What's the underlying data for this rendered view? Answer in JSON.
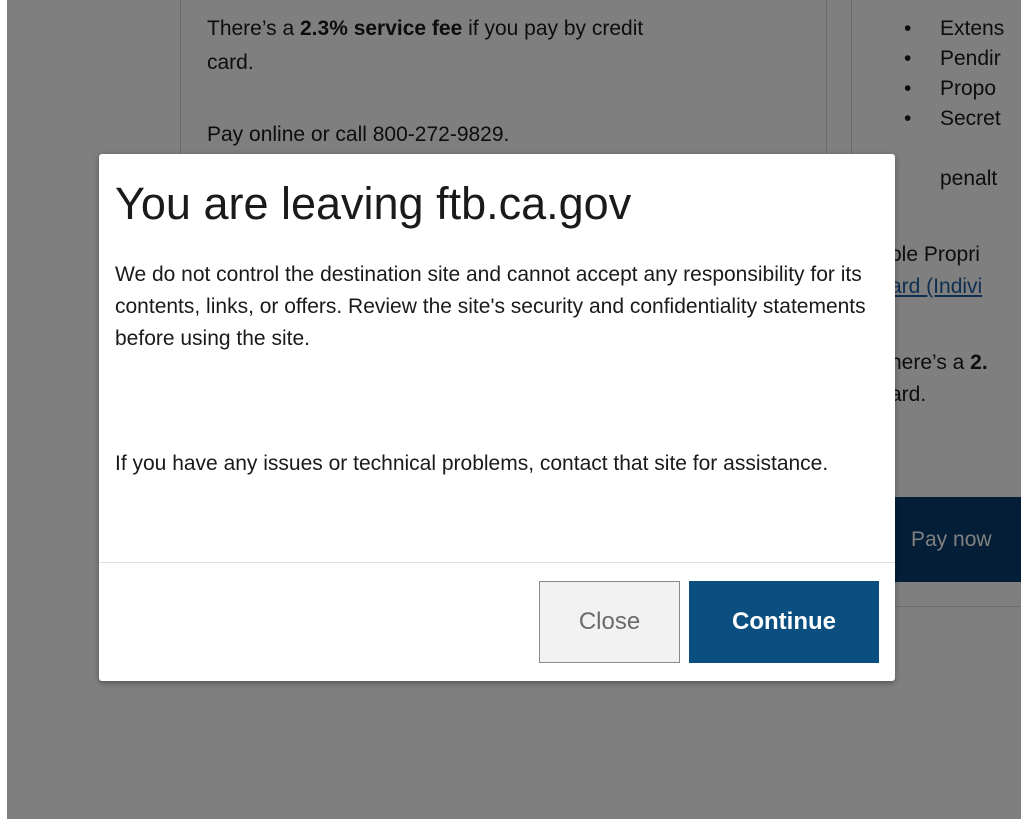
{
  "background": {
    "left_card": {
      "fee_prefix": "There’s a ",
      "fee_bold": "2.3% service fee",
      "fee_suffix": " if you pay by credit",
      "fee_line2": "card.",
      "pay_text": "Pay online or call 800-272-9829."
    },
    "right_card": {
      "bullets": [
        "Extens",
        "Pendir",
        "Propo",
        "Secret"
      ],
      "bullet_continuation": "penalt",
      "sole_prop": "ole Propri",
      "card_link": "ard (Indivi",
      "fee_prefix": "here’s a ",
      "fee_bold": "2.",
      "fee_line2": "ard.",
      "pay_now_label": "Pay now"
    }
  },
  "modal": {
    "title": "You are leaving ftb.ca.gov",
    "paragraph1": "We do not control the destination site and cannot accept any responsibility for its contents, links, or offers. Review the site's security and confidentiality statements before using the site.",
    "paragraph2": "If you have any issues or technical problems, contact that site for assistance.",
    "close_label": "Close",
    "continue_label": "Continue"
  },
  "colors": {
    "overlay": "rgba(0,0,0,0.5)",
    "primary_button": "#0b4e80",
    "pay_now_button": "#0b3d6e",
    "link": "#1f5fa6"
  }
}
